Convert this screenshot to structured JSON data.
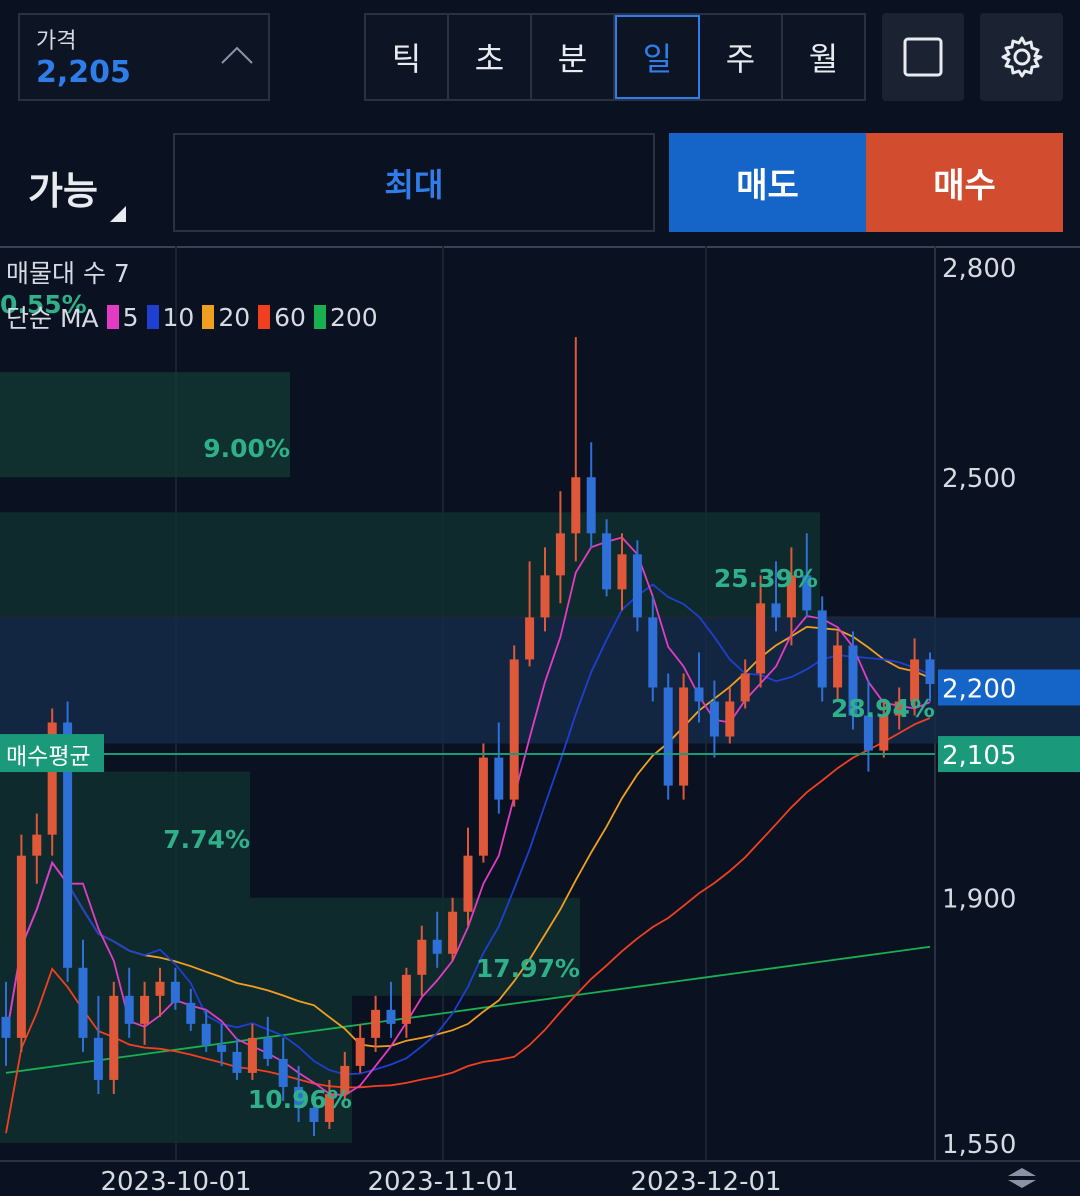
{
  "price_box": {
    "label": "가격",
    "value": "2,205"
  },
  "period_tabs": [
    {
      "label": "틱",
      "active": false
    },
    {
      "label": "초",
      "active": false
    },
    {
      "label": "분",
      "active": false
    },
    {
      "label": "일",
      "active": true
    },
    {
      "label": "주",
      "active": false
    },
    {
      "label": "월",
      "active": false
    }
  ],
  "order": {
    "available_label": "가능",
    "max_label": "최대",
    "sell_label": "매도",
    "buy_label": "매수"
  },
  "chart_legend": {
    "volume_profile": "매물대 수 7",
    "ma_prefix": "단순 MA",
    "ma_periods": [
      {
        "label": "5",
        "color": "#e23cc5"
      },
      {
        "label": "10",
        "color": "#1e3fd0"
      },
      {
        "label": "20",
        "color": "#f0a020"
      },
      {
        "label": "60",
        "color": "#f04020"
      },
      {
        "label": "200",
        "color": "#18b050"
      }
    ]
  },
  "colors": {
    "accent": "#2f7de8",
    "sell": "#1565c8",
    "buy": "#d24d2f",
    "up_candle": "#e0583a",
    "down_candle": "#2f6fd8",
    "avg_line": "#1a9a7a"
  },
  "chart_data": {
    "type": "candlestick",
    "y_ticks": [
      "2,800",
      "2,500",
      "2,200",
      "1,900",
      "1,550"
    ],
    "x_ticks": [
      "2023-10-01",
      "2023-11-01",
      "2023-12-01"
    ],
    "current_price_label": "2,200",
    "avg_buy_price_label": "2,105",
    "avg_buy_text": "매수평균",
    "volume_profile_labels": [
      "0.55%",
      "9.00%",
      "25.39%",
      "28.94%",
      "7.74%",
      "17.97%",
      "10.96%"
    ],
    "candles": [
      [
        1730,
        1780,
        1660,
        1700
      ],
      [
        1700,
        1990,
        1680,
        1960
      ],
      [
        1960,
        2020,
        1920,
        1990
      ],
      [
        1990,
        2170,
        1960,
        2150
      ],
      [
        2150,
        2180,
        1780,
        1800
      ],
      [
        1800,
        1840,
        1680,
        1700
      ],
      [
        1700,
        1760,
        1620,
        1640
      ],
      [
        1640,
        1780,
        1620,
        1760
      ],
      [
        1760,
        1800,
        1700,
        1720
      ],
      [
        1720,
        1780,
        1690,
        1760
      ],
      [
        1760,
        1800,
        1730,
        1780
      ],
      [
        1780,
        1800,
        1740,
        1750
      ],
      [
        1750,
        1770,
        1710,
        1720
      ],
      [
        1720,
        1740,
        1680,
        1690
      ],
      [
        1690,
        1720,
        1660,
        1680
      ],
      [
        1680,
        1700,
        1640,
        1650
      ],
      [
        1650,
        1720,
        1640,
        1700
      ],
      [
        1700,
        1730,
        1660,
        1670
      ],
      [
        1670,
        1700,
        1610,
        1630
      ],
      [
        1630,
        1660,
        1580,
        1600
      ],
      [
        1600,
        1620,
        1560,
        1580
      ],
      [
        1580,
        1640,
        1570,
        1620
      ],
      [
        1620,
        1680,
        1610,
        1660
      ],
      [
        1660,
        1720,
        1650,
        1700
      ],
      [
        1700,
        1760,
        1680,
        1740
      ],
      [
        1740,
        1780,
        1700,
        1720
      ],
      [
        1720,
        1800,
        1700,
        1790
      ],
      [
        1790,
        1860,
        1760,
        1840
      ],
      [
        1840,
        1880,
        1800,
        1820
      ],
      [
        1820,
        1900,
        1810,
        1880
      ],
      [
        1880,
        2000,
        1860,
        1960
      ],
      [
        1960,
        2120,
        1950,
        2100
      ],
      [
        2100,
        2150,
        2020,
        2040
      ],
      [
        2040,
        2260,
        2030,
        2240
      ],
      [
        2240,
        2380,
        2230,
        2300
      ],
      [
        2300,
        2400,
        2280,
        2360
      ],
      [
        2360,
        2480,
        2320,
        2420
      ],
      [
        2420,
        2700,
        2380,
        2500
      ],
      [
        2500,
        2550,
        2400,
        2420
      ],
      [
        2420,
        2440,
        2330,
        2340
      ],
      [
        2340,
        2420,
        2310,
        2390
      ],
      [
        2390,
        2410,
        2280,
        2300
      ],
      [
        2300,
        2330,
        2180,
        2200
      ],
      [
        2200,
        2220,
        2040,
        2060
      ],
      [
        2060,
        2220,
        2040,
        2200
      ],
      [
        2200,
        2250,
        2150,
        2180
      ],
      [
        2180,
        2210,
        2100,
        2130
      ],
      [
        2130,
        2200,
        2120,
        2180
      ],
      [
        2180,
        2240,
        2170,
        2220
      ],
      [
        2220,
        2360,
        2200,
        2320
      ],
      [
        2320,
        2380,
        2280,
        2300
      ],
      [
        2300,
        2400,
        2260,
        2360
      ],
      [
        2360,
        2420,
        2300,
        2310
      ],
      [
        2310,
        2330,
        2180,
        2200
      ],
      [
        2200,
        2280,
        2180,
        2260
      ],
      [
        2260,
        2280,
        2140,
        2160
      ],
      [
        2160,
        2210,
        2080,
        2110
      ],
      [
        2110,
        2180,
        2100,
        2160
      ],
      [
        2160,
        2200,
        2140,
        2180
      ],
      [
        2180,
        2270,
        2160,
        2240
      ],
      [
        2240,
        2250,
        2180,
        2205
      ]
    ]
  }
}
